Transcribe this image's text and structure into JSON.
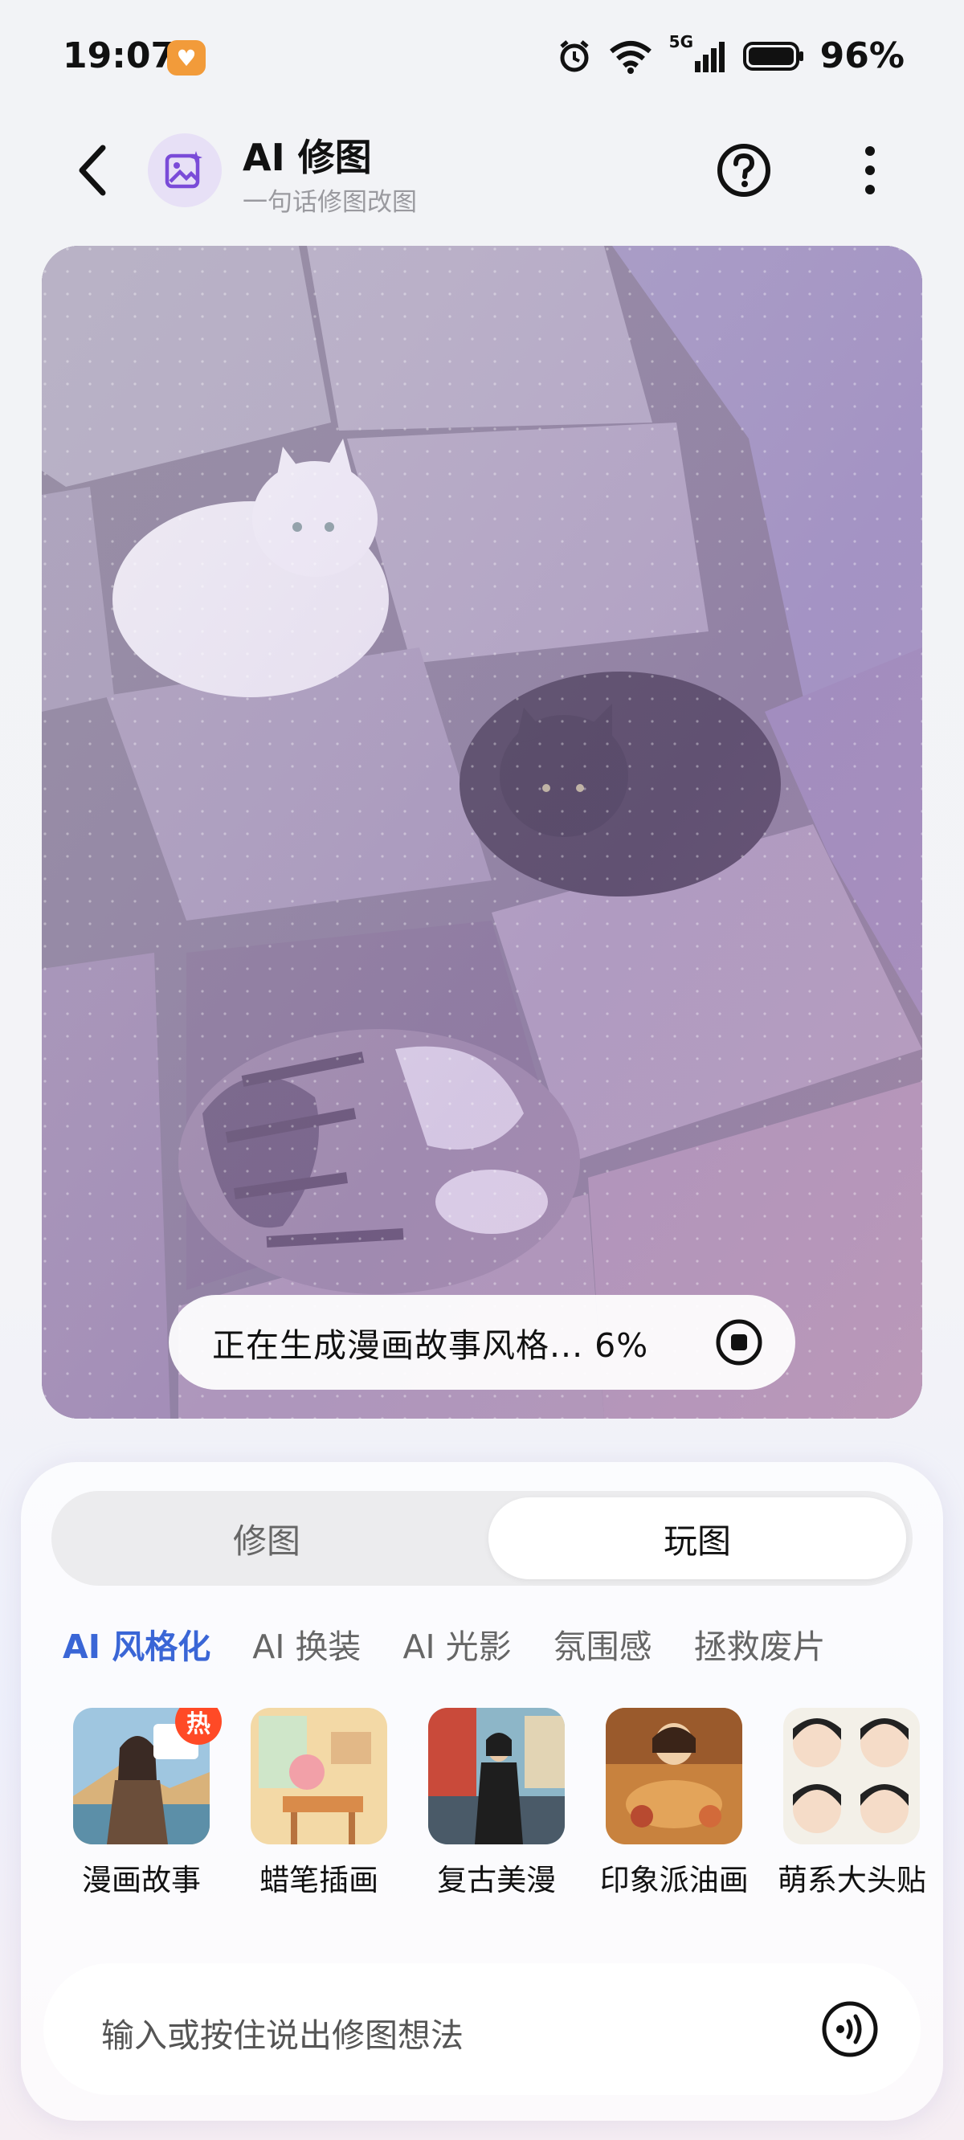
{
  "status_bar": {
    "time": "19:07",
    "notification_icon": "heart-app-icon",
    "network_label": "5G",
    "battery_percent": "96%"
  },
  "header": {
    "back_icon": "chevron-left-icon",
    "app_icon": "magic-image-icon",
    "title": "AI 修图",
    "subtitle": "一句话修图改图",
    "help_icon": "question-circle-icon",
    "more_icon": "vertical-dots-icon"
  },
  "preview": {
    "progress_text": "正在生成漫画故事风格... 6%",
    "progress_value": 0.06,
    "stop_icon": "stop-circle-icon"
  },
  "panel": {
    "tabs": [
      {
        "label": "修图",
        "selected": false
      },
      {
        "label": "玩图",
        "selected": true
      }
    ],
    "categories": [
      {
        "label": "AI 风格化",
        "active": true
      },
      {
        "label": "AI 换装",
        "active": false
      },
      {
        "label": "AI 光影",
        "active": false
      },
      {
        "label": "氛围感",
        "active": false
      },
      {
        "label": "拯救废片",
        "active": false
      }
    ],
    "styles": [
      {
        "label": "漫画故事",
        "badge": "热"
      },
      {
        "label": "蜡笔插画",
        "badge": ""
      },
      {
        "label": "复古美漫",
        "badge": ""
      },
      {
        "label": "印象派油画",
        "badge": ""
      },
      {
        "label": "萌系大头贴",
        "badge": ""
      }
    ],
    "input_placeholder": "输入或按住说出修图想法",
    "voice_icon": "voice-wave-icon"
  },
  "colors": {
    "accent": "#3a66d6",
    "hot_badge": "#ff4a26",
    "app_badge_bg": "#e7e0f6"
  }
}
